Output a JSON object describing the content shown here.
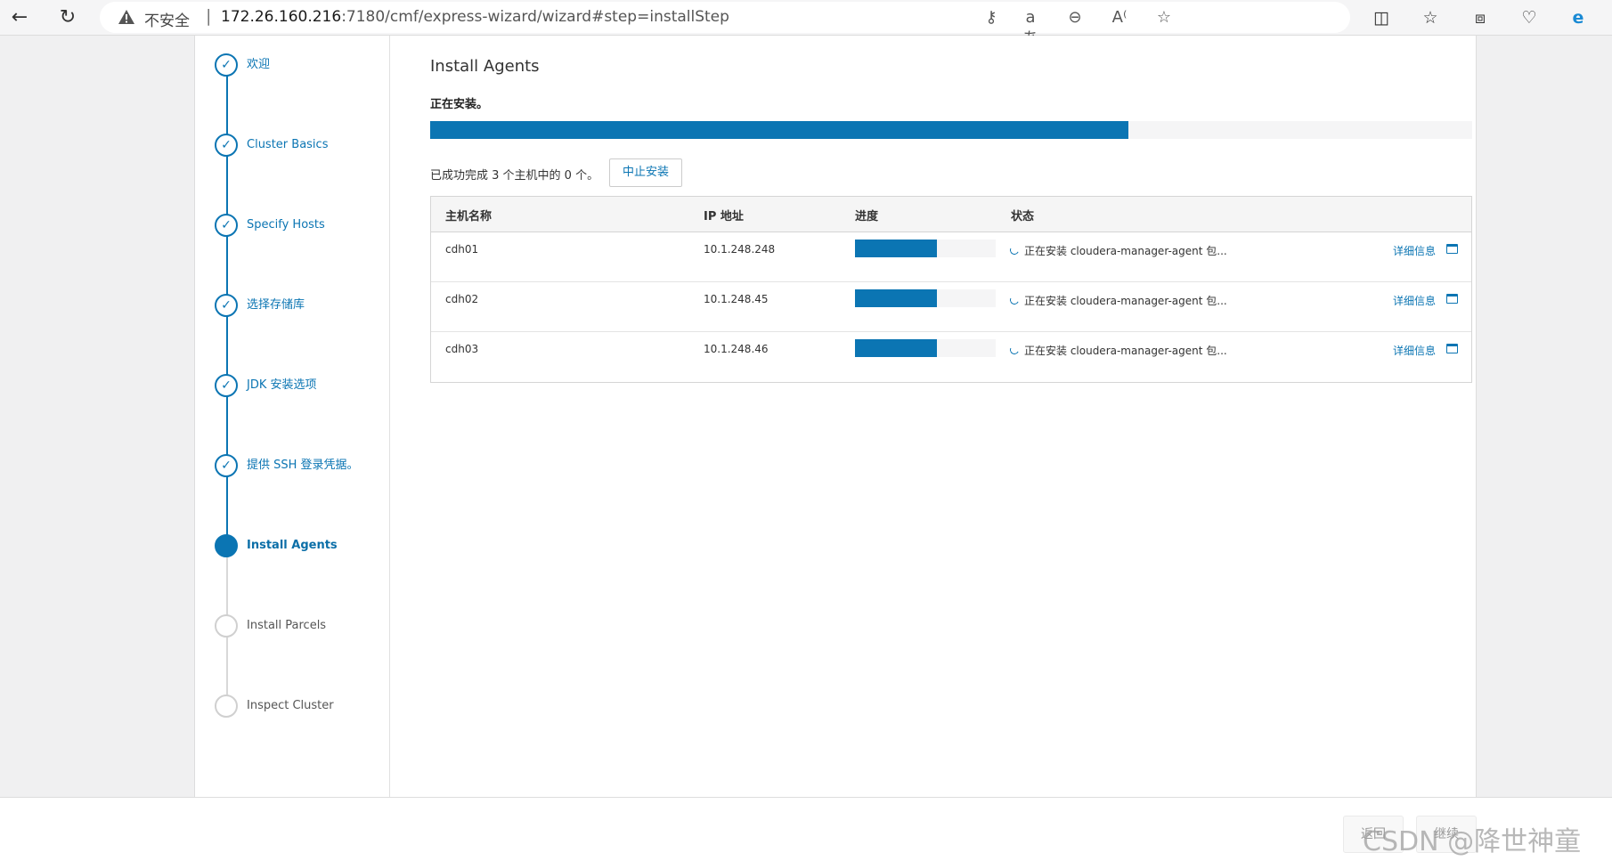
{
  "browser": {
    "security_label": "不安全",
    "url_host": "172.26.160.216",
    "url_path": ":7180/cmf/express-wizard/wizard#step=installStep",
    "icons": [
      "back-icon",
      "reload-icon",
      "warning-icon",
      "key-icon",
      "translate-icon",
      "zoom-out-icon",
      "read-aloud-icon",
      "favorite-star-icon",
      "split-screen-icon",
      "favorites-icon",
      "collections-icon",
      "browser-essentials-icon",
      "edge-copilot-icon"
    ]
  },
  "sidebar": {
    "steps": [
      {
        "label": "欢迎",
        "state": "done"
      },
      {
        "label": "Cluster Basics",
        "state": "done"
      },
      {
        "label": "Specify Hosts",
        "state": "done"
      },
      {
        "label": "选择存储库",
        "state": "done"
      },
      {
        "label": "JDK 安装选项",
        "state": "done"
      },
      {
        "label": "提供 SSH 登录凭据。",
        "state": "done"
      },
      {
        "label": "Install Agents",
        "state": "active"
      },
      {
        "label": "Install Parcels",
        "state": "pending"
      },
      {
        "label": "Inspect Cluster",
        "state": "pending"
      }
    ]
  },
  "main": {
    "title": "Install Agents",
    "status": "正在安装。",
    "overall_progress": 0.67,
    "summary": "已成功完成 3 个主机中的 0 个。",
    "abort_label": "中止安装",
    "table": {
      "headers": [
        "主机名称",
        "IP 地址",
        "进度",
        "状态"
      ],
      "rows": [
        {
          "host": "cdh01",
          "ip": "10.1.248.248",
          "progress": 0.58,
          "status": "正在安装 cloudera-manager-agent 包...",
          "detail": "详细信息"
        },
        {
          "host": "cdh02",
          "ip": "10.1.248.45",
          "progress": 0.58,
          "status": "正在安装 cloudera-manager-agent 包...",
          "detail": "详细信息"
        },
        {
          "host": "cdh03",
          "ip": "10.1.248.46",
          "progress": 0.58,
          "status": "正在安装 cloudera-manager-agent 包...",
          "detail": "详细信息"
        }
      ]
    }
  },
  "footer": {
    "back_label": "返回",
    "continue_label": "继续",
    "watermark": "CSDN @降世神童"
  },
  "colors": {
    "accent": "#0b75b3",
    "track": "#f5f5f6",
    "pending": "#d0d0d0"
  }
}
